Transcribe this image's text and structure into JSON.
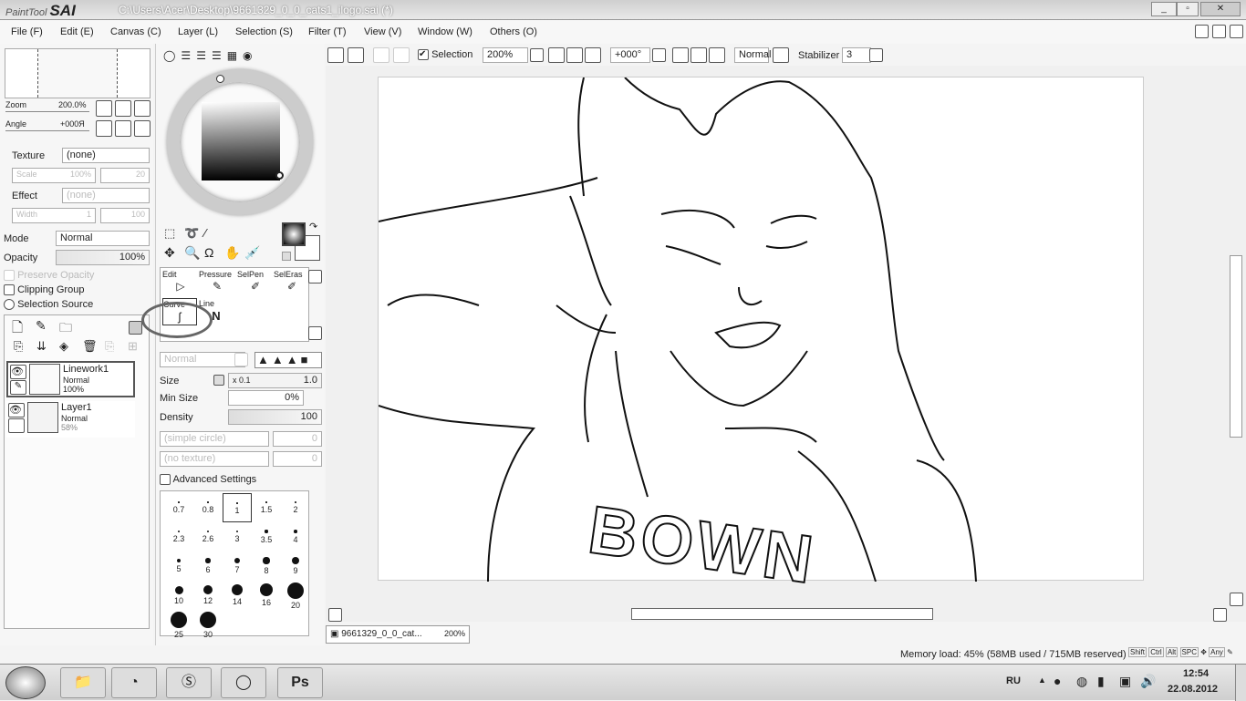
{
  "title": {
    "app": "PaintTool",
    "app_bold": "SAI",
    "path": "C:\\Users\\Acer\\Desktop\\9661329_0_0_cats1_ilogo.sai (*)"
  },
  "menu": [
    "File (F)",
    "Edit (E)",
    "Canvas (C)",
    "Layer (L)",
    "Selection (S)",
    "Filter (T)",
    "View (V)",
    "Window (W)",
    "Others (O)"
  ],
  "navigator": {
    "zoom_label": "Zoom",
    "zoom_value": "200.0%",
    "angle_label": "Angle",
    "angle_value": "+000Я"
  },
  "texture": {
    "label": "Texture",
    "value": "(none)",
    "scale_label": "Scale",
    "scale_value": "100%",
    "scale_amt": "20"
  },
  "effect": {
    "label": "Effect",
    "value": "(none)",
    "width_label": "Width",
    "width_value": "1",
    "width_amt": "100"
  },
  "layer_props": {
    "mode_label": "Mode",
    "mode_value": "Normal",
    "opacity_label": "Opacity",
    "opacity_value": "100%",
    "opacity_pct": 100,
    "preserve_opacity": "Preserve Opacity",
    "clipping_group": "Clipping Group",
    "selection_source": "Selection Source"
  },
  "layers": [
    {
      "name": "Linework1",
      "mode": "Normal",
      "opacity": "100%"
    },
    {
      "name": "Layer1",
      "mode": "Normal",
      "opacity": "58%"
    }
  ],
  "tools": [
    {
      "label": "Edit"
    },
    {
      "label": "Pressure"
    },
    {
      "label": "SelPen"
    },
    {
      "label": "SelEras"
    },
    {
      "label": "Curve"
    },
    {
      "label": "Line"
    }
  ],
  "brush": {
    "blend": "Normal",
    "size_label": "Size",
    "size_mult": "x 0.1",
    "size_value": "1.0",
    "minsize_label": "Min Size",
    "minsize_value": "0%",
    "density_label": "Density",
    "density_value": "100",
    "shape": "(simple circle)",
    "shape_amt": "0",
    "texture": "(no texture)",
    "texture_amt": "0",
    "advanced": "Advanced Settings"
  },
  "brush_sizes": [
    "0.7",
    "0.8",
    "1",
    "1.5",
    "2",
    "2.3",
    "2.6",
    "3",
    "3.5",
    "4",
    "5",
    "6",
    "7",
    "8",
    "9",
    "10",
    "12",
    "14",
    "16",
    "20",
    "25",
    "30"
  ],
  "selected_brush_size": "1",
  "toolbar": {
    "selection_label": "Selection",
    "selection_checked": true,
    "zoom": "200%",
    "angle": "+000°",
    "blend": "Normal",
    "stabilizer_label": "Stabilizer",
    "stabilizer_value": "3"
  },
  "doc_tab": {
    "name": "9661329_0_0_cat...",
    "zoom": "200%"
  },
  "status": {
    "memory": "Memory load: 45% (58MB used / 715MB reserved)",
    "keys": [
      "Shift",
      "Ctrl",
      "Alt",
      "SPC",
      "Any"
    ]
  },
  "taskbar": {
    "lang": "RU",
    "time": "12:54",
    "date": "22.08.2012",
    "apps": [
      "explorer",
      "paint",
      "skype",
      "browser",
      "photoshop"
    ],
    "ps_label": "Ps"
  },
  "canvas_text": "BOWN"
}
